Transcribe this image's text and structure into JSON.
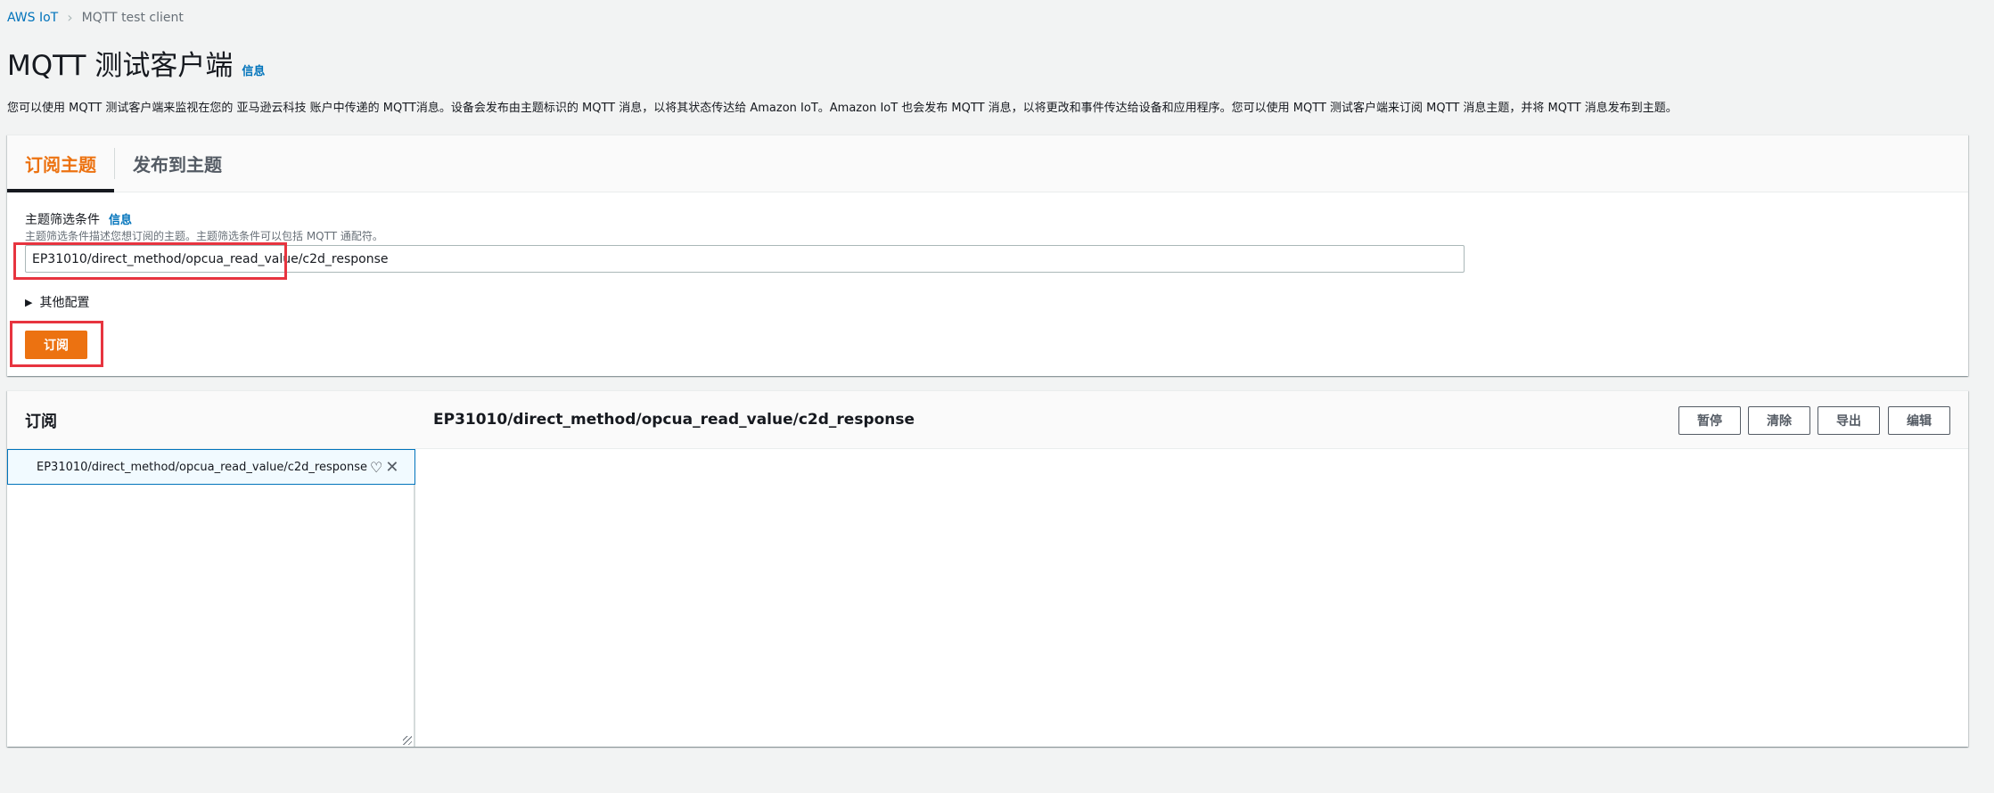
{
  "breadcrumb": [
    {
      "label": "AWS IoT"
    },
    {
      "label": "MQTT test client"
    }
  ],
  "header": {
    "title": "MQTT 测试客户端",
    "info": "信息"
  },
  "description": "您可以使用 MQTT 测试客户端来监视在您的 亚马逊云科技 账户中传递的 MQTT消息。设备会发布由主题标识的 MQTT 消息，以将其状态传达给 Amazon IoT。Amazon IoT 也会发布 MQTT 消息，以将更改和事件传达给设备和应用程序。您可以使用 MQTT 测试客户端来订阅 MQTT 消息主题，并将 MQTT 消息发布到主题。",
  "tabs": [
    {
      "label": "订阅主题",
      "active": true
    },
    {
      "label": "发布到主题",
      "active": false
    }
  ],
  "subscribe_form": {
    "label": "主题筛选条件",
    "info": "信息",
    "help": "主题筛选条件描述您想订阅的主题。主题筛选条件可以包括 MQTT 通配符。",
    "topic_value": "EP31010/direct_method/opcua_read_value/c2d_response",
    "more_config": "其他配置",
    "subscribe_button": "订阅"
  },
  "subscriptions": {
    "title": "订阅",
    "selected_topic": "EP31010/direct_method/opcua_read_value/c2d_response",
    "items": [
      {
        "topic": "EP31010/direct_method/opcua_read_value/c2d_response",
        "favorite_icon": "heart-icon",
        "close_icon": "close-icon"
      }
    ],
    "toolbar": {
      "pause": "暂停",
      "clear": "清除",
      "export": "导出",
      "edit": "编辑"
    }
  },
  "colors": {
    "accent": "#ec7211",
    "link": "#0073bb",
    "highlight": "#e7343f"
  }
}
